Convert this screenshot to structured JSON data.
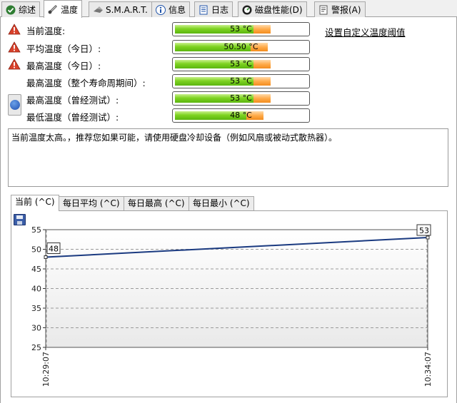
{
  "tabs": [
    {
      "label": "综述",
      "icon": "check-icon"
    },
    {
      "label": "温度",
      "icon": "thermometer-icon",
      "active": true
    },
    {
      "label": "S.M.A.R.T.",
      "icon": "smart-icon"
    },
    {
      "label": "信息",
      "icon": "info-icon"
    },
    {
      "label": "日志",
      "icon": "log-icon"
    },
    {
      "label": "磁盘性能(D)",
      "icon": "disk-performance-icon"
    },
    {
      "label": "警报(A)",
      "icon": "alert-icon"
    }
  ],
  "temperatures": [
    {
      "label": "当前温度:",
      "value": "53 °C",
      "warning": true,
      "fill_pct": 72
    },
    {
      "label": "平均温度（今日）:",
      "value": "50.50 °C",
      "warning": true,
      "fill_pct": 69
    },
    {
      "label": "最高温度（今日）:",
      "value": "53 °C",
      "warning": true,
      "fill_pct": 72
    },
    {
      "label": "最高温度（整个寿命周期间）:",
      "value": "53 °C",
      "warning": false,
      "fill_pct": 72
    },
    {
      "label": "最高温度（曾经测试）:",
      "value": "53 °C",
      "warning": false,
      "fill_pct": 72
    },
    {
      "label": "最低温度（曾经测试）:",
      "value": "48 °C",
      "warning": false,
      "fill_pct": 66
    }
  ],
  "threshold_link": "设置自定义温度阈值",
  "message": "当前温度太高。，推荐您如果可能，请使用硬盘冷却设备（例如风扇或被动式散热器）。",
  "subtabs": [
    "当前 (^C)",
    "每日平均 (^C)",
    "每日最高 (^C)",
    "每日最小 (^C)"
  ],
  "chart_data": {
    "type": "line",
    "x": [
      "10:29:07",
      "10:34:07"
    ],
    "values": [
      48,
      53
    ],
    "start_label": "48",
    "end_label": "53",
    "ylim": [
      25,
      55
    ],
    "yticks": [
      25,
      30,
      35,
      40,
      45,
      50,
      55
    ],
    "grid": true,
    "line_color": "#1a3a80"
  },
  "colors": {
    "bar_green": "#7ed321",
    "bar_orange": "#f7a23b",
    "warning": "#d9412b"
  }
}
